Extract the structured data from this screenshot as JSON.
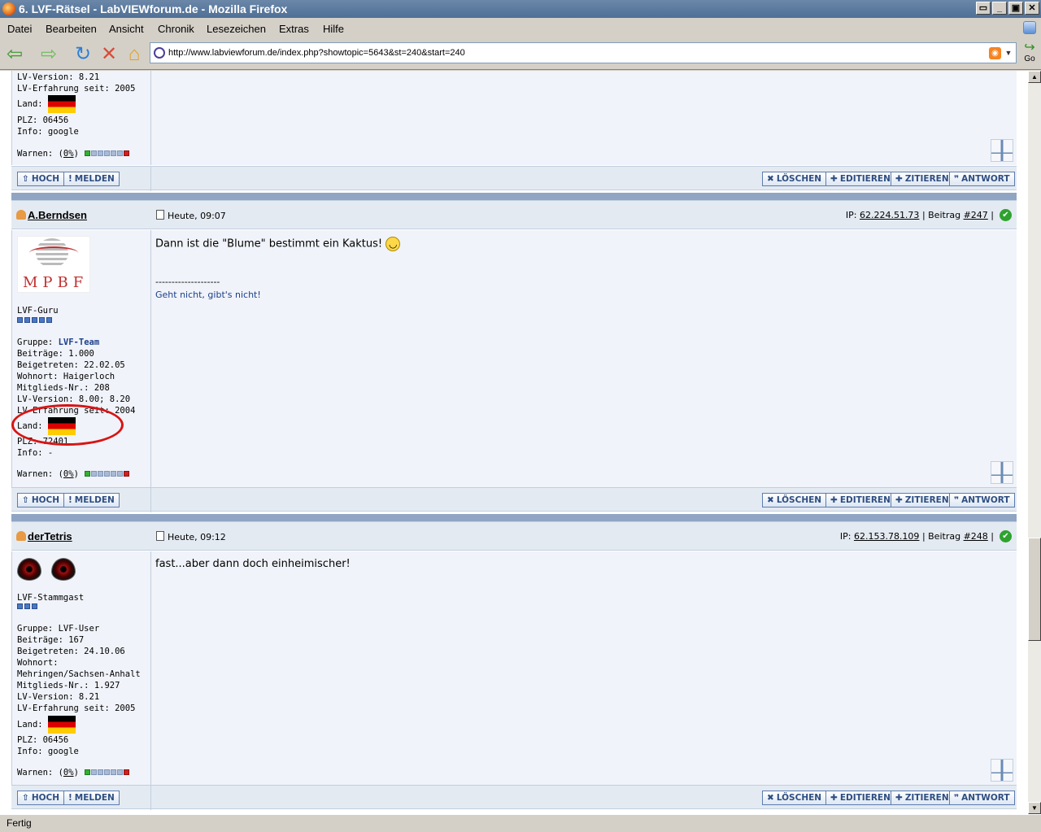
{
  "window": {
    "title": "6. LVF-Rätsel - LabVIEWforum.de - Mozilla Firefox"
  },
  "menu": [
    "Datei",
    "Bearbeiten",
    "Ansicht",
    "Chronik",
    "Lesezeichen",
    "Extras",
    "Hilfe"
  ],
  "nav": {
    "url": "http://www.labviewforum.de/index.php?showtopic=5643&st=240&start=240",
    "go": "Go"
  },
  "status": "Fertig",
  "top_post": {
    "info": "LV-Version: 8.21\nLV-Erfahrung seit: 2005",
    "land_label": "Land:",
    "info2": "PLZ: 06456\nInfo: google",
    "warn_label": "Warnen: (",
    "warn_pct": "0%",
    "warn_close": ")"
  },
  "buttons": {
    "hoch": "HOCH",
    "melden": "MELDEN",
    "loeschen": "LÖSCHEN",
    "editieren": "EDITIEREN",
    "zitieren": "ZITIEREN",
    "antwort": "ANTWORT"
  },
  "post1": {
    "user": "A.Berndsen",
    "avatar_text": "MPBF",
    "date": "Heute, 09:07",
    "ip_label": "IP:",
    "ip": "62.224.51.73",
    "beitrag_label": "| Beitrag",
    "beitrag": "#247",
    "rank": "LVF-Guru",
    "gruppe_label": "Gruppe:",
    "gruppe": "LVF-Team",
    "info": "Beiträge: 1.000\nBeigetreten: 22.02.05\nWohnort: Haigerloch\nMitglieds-Nr.: 208\nLV-Version: 8.00; 8.20\nLV-Erfahrung seit: 2004",
    "land_label": "Land:",
    "info2": "PLZ: 72401\nInfo: -",
    "warn_label": "Warnen: (",
    "warn_pct": "0%",
    "warn_close": ")",
    "message": "Dann ist die \"Blume\" bestimmt ein Kaktus!",
    "sig_line": "--------------------",
    "sig_text": "Geht nicht, gibt's nicht!"
  },
  "post2": {
    "user": "derTetris",
    "date": "Heute, 09:12",
    "ip_label": "IP:",
    "ip": "62.153.78.109",
    "beitrag_label": "| Beitrag",
    "beitrag": "#248",
    "rank": "LVF-Stammgast",
    "info": "Gruppe: LVF-User\nBeiträge: 167\nBeigetreten: 24.10.06\nWohnort:\nMehringen/Sachsen-Anhalt\nMitglieds-Nr.: 1.927\nLV-Version: 8.21\nLV-Erfahrung seit: 2005",
    "land_label": "Land:",
    "info2": "PLZ: 06456\nInfo: google",
    "warn_label": "Warnen: (",
    "warn_pct": "0%",
    "warn_close": ")",
    "message": "fast...aber dann doch einheimischer!"
  }
}
